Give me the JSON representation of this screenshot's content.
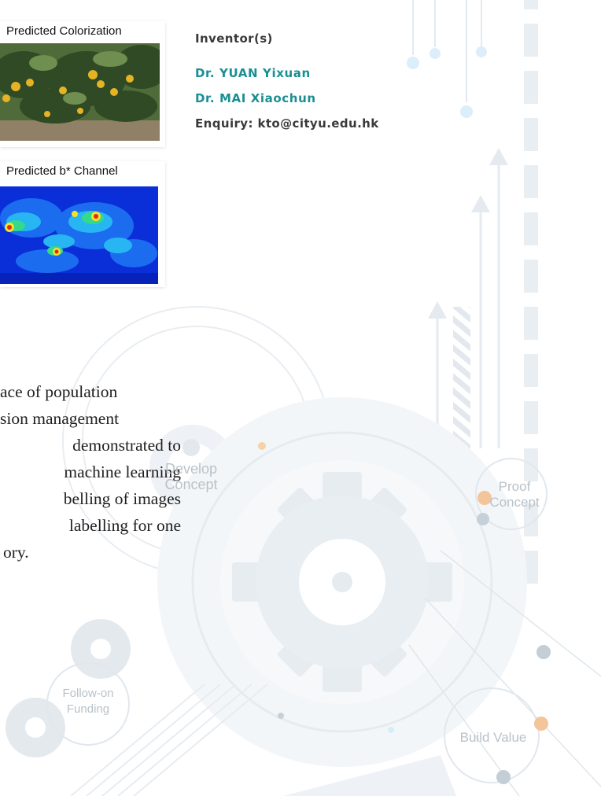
{
  "figures": {
    "top_caption": "Predicted Colorization",
    "bottom_caption": "Predicted b* Channel"
  },
  "inventor": {
    "heading": "Inventor(s)",
    "names": [
      "Dr. YUAN Yixuan",
      "Dr. MAI Xiaochun"
    ],
    "enquiry": "Enquiry: kto@cityu.edu.hk"
  },
  "paragraph": {
    "lines": [
      "ace of population",
      "sion management",
      "demonstrated to",
      "machine learning",
      "belling of images",
      "labelling for one",
      "ory."
    ]
  },
  "stages": {
    "develop": [
      "Develop",
      "Concept"
    ],
    "proof": [
      "Proof",
      "Concept"
    ],
    "follow_on": [
      "Follow-on",
      "Funding"
    ],
    "build_value": "Build Value"
  },
  "colors": {
    "accent_teal": "#1a8f93",
    "text_dark": "#3a3a3a",
    "decor_light": "#e6edf3",
    "decor_mid": "#c9d3dc",
    "dot_orange": "#f5c49a",
    "dot_blue": "#d4eef9"
  }
}
